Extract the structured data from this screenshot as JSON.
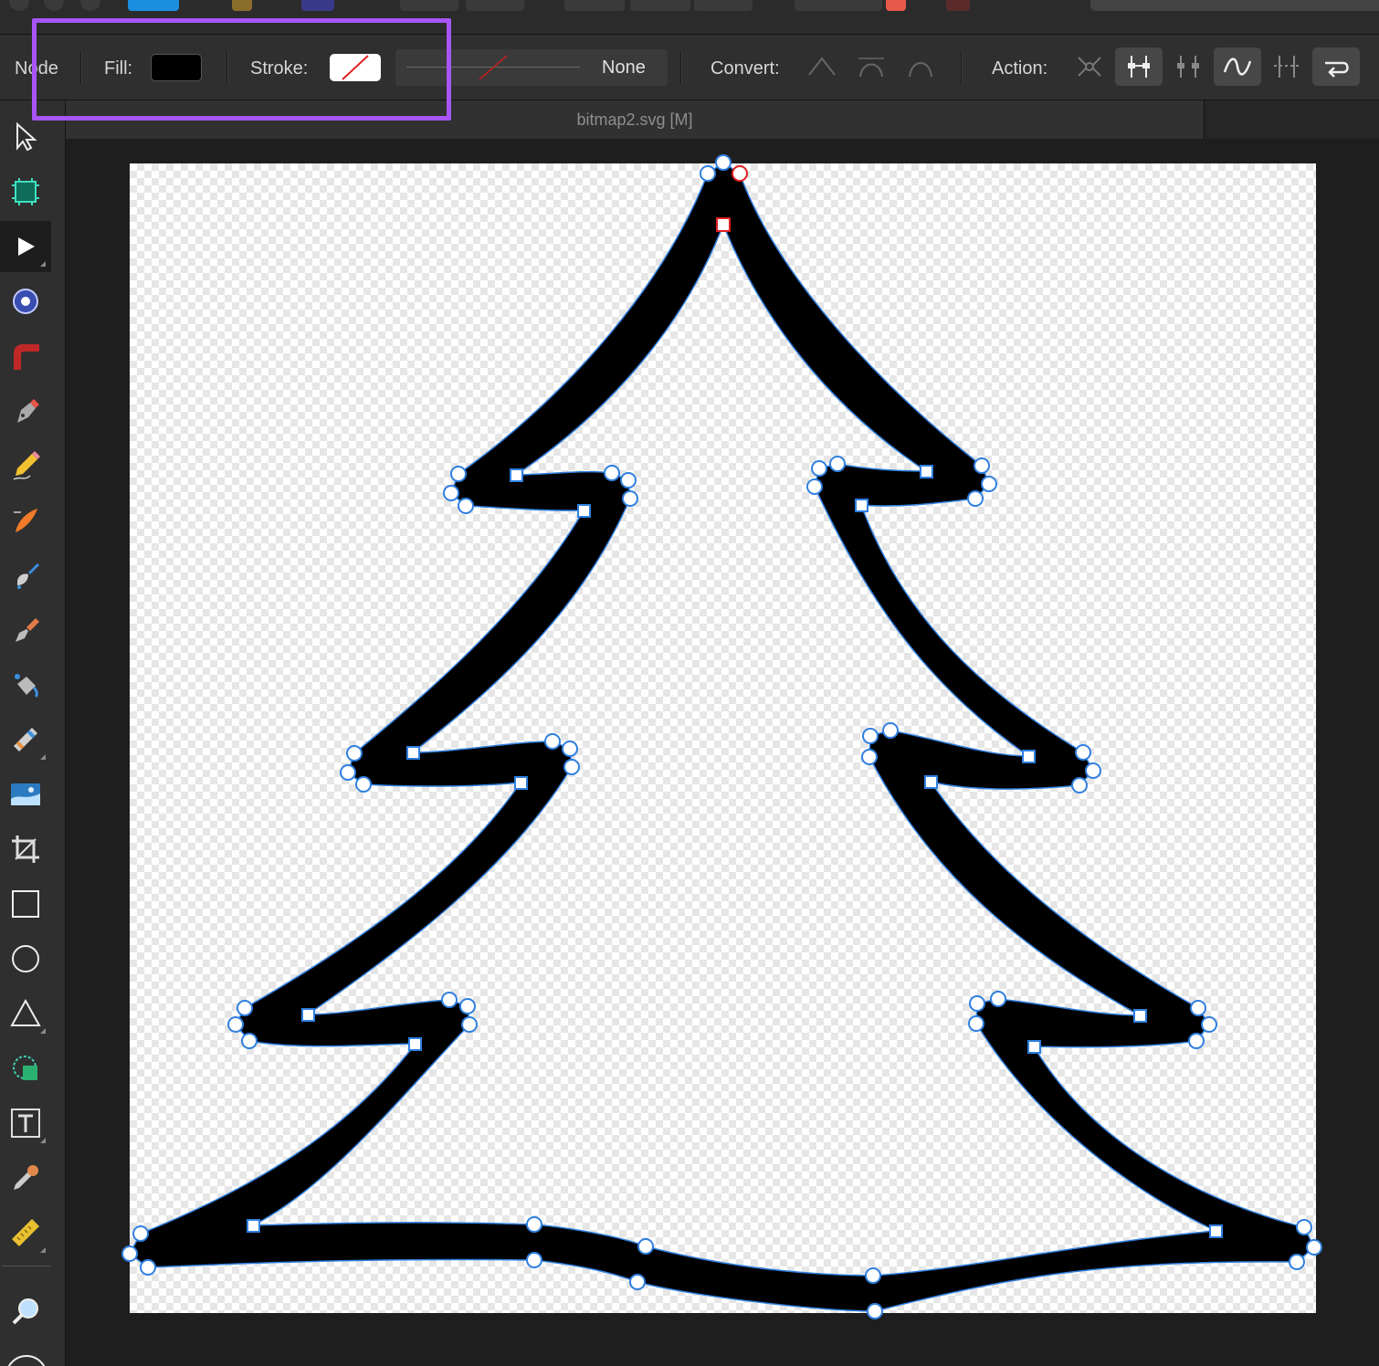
{
  "context_bar": {
    "mode_label": "Node",
    "fill_label": "Fill:",
    "fill_color": "#000000",
    "stroke_label": "Stroke:",
    "stroke_color": "none",
    "stroke_style_value": "None",
    "convert_label": "Convert:",
    "action_label": "Action:"
  },
  "document": {
    "tab_title": "bitmap2.svg [M]"
  },
  "tools": [
    "move-tool",
    "artboard-tool",
    "node-tool",
    "point-transform-tool",
    "corner-tool",
    "pen-tool",
    "pencil-tool",
    "vector-brush-tool",
    "paint-brush-tool",
    "pixel-brush-tool",
    "fill-tool",
    "transparency-tool",
    "place-image-tool",
    "crop-tool",
    "rectangle-tool",
    "ellipse-tool",
    "triangle-tool",
    "shape-builder-tool",
    "text-tool",
    "color-picker-tool",
    "measure-tool",
    "zoom-tool"
  ],
  "colors": {
    "highlight": "#a855f7",
    "selection": "#2f7fe0",
    "selected_node": "#e02020"
  }
}
